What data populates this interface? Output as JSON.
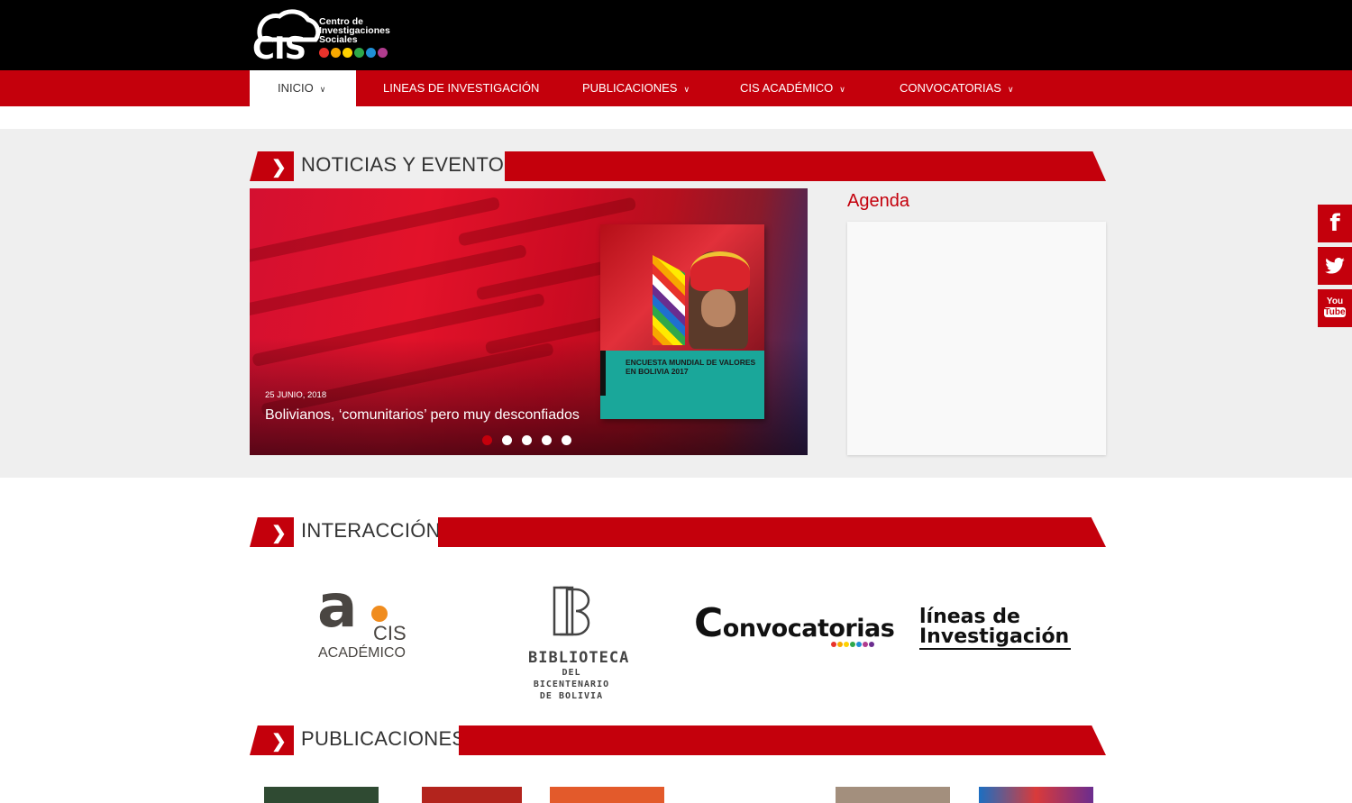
{
  "header": {
    "logo_text_line1": "Centro de",
    "logo_text_line2": "Investigaciones",
    "logo_text_line3": "Sociales",
    "logo_mark": "CIS",
    "logo_dot_colors": [
      "#e8322b",
      "#f7a800",
      "#ffd200",
      "#2ea84a",
      "#1f8fd6",
      "#b03c8e"
    ]
  },
  "nav": {
    "items": [
      {
        "label": "INICIO",
        "active": true
      },
      {
        "label": "LINEAS DE INVESTIGACIÓN"
      },
      {
        "label": "PUBLICACIONES"
      },
      {
        "label": "CIS ACADÉMICO"
      },
      {
        "label": "CONVOCATORIAS"
      }
    ]
  },
  "news": {
    "section_title": "NOTICIAS Y EVENTOS",
    "slide": {
      "date": "25 JUNIO, 2018",
      "caption": "Bolivianos, ‘comunitarios’ pero muy desconfiados",
      "book_title": "ENCUESTA MUNDIAL DE VALORES EN BOLIVIA 2017"
    },
    "dots_active_index": 0,
    "agenda_title": "Agenda"
  },
  "interaccion": {
    "section_title": "INTERACCIÓN",
    "academico": {
      "letter": "a",
      "cis": "CIS",
      "sub": "ACADÉMICO"
    },
    "biblioteca": {
      "line1": "BIBLIOTECA",
      "line2": "DEL BICENTENARIO",
      "line3": "DE BOLIVIA"
    },
    "convocatorias": {
      "big": "C",
      "rest": "onvocatorias"
    },
    "lineas": {
      "line1": "líneas de",
      "line2": "Investigación"
    }
  },
  "publicaciones": {
    "section_title": "PUBLICACIONES"
  },
  "social": {
    "facebook": "f",
    "youtube_top": "You",
    "youtube_bottom": "Tube"
  },
  "colors": {
    "brand_red": "#c4000c",
    "header_black": "#000000"
  }
}
